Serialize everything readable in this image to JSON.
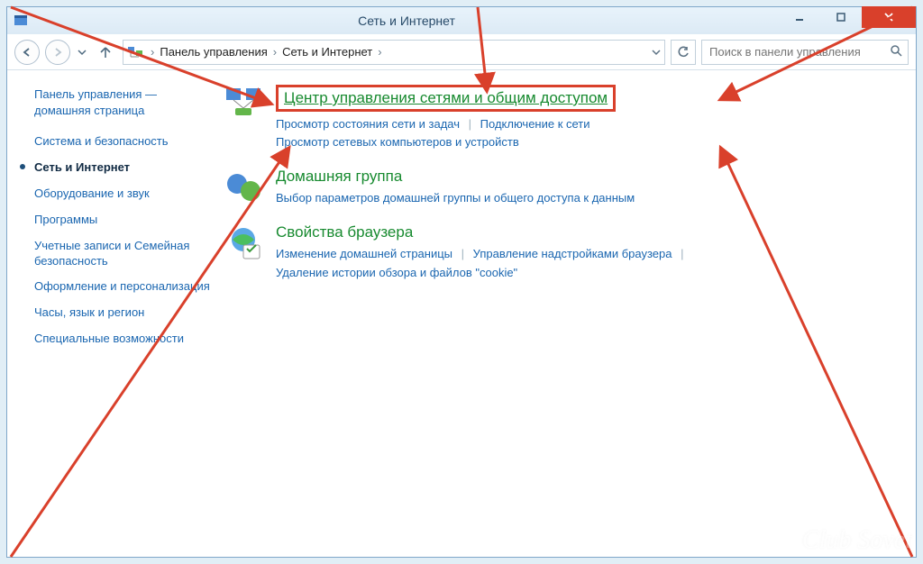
{
  "titlebar": {
    "title": "Сеть и Интернет"
  },
  "nav": {
    "crumb1": "Панель управления",
    "crumb2": "Сеть и Интернет",
    "search_placeholder": "Поиск в панели управления"
  },
  "sidebar": {
    "home_l1": "Панель управления —",
    "home_l2": "домашняя страница",
    "items": [
      {
        "label": "Система и безопасность"
      },
      {
        "label": "Сеть и Интернет"
      },
      {
        "label": "Оборудование и звук"
      },
      {
        "label": "Программы"
      },
      {
        "label": "Учетные записи и Семейная безопасность"
      },
      {
        "label": "Оформление и персонализация"
      },
      {
        "label": "Часы, язык и регион"
      },
      {
        "label": "Специальные возможности"
      }
    ]
  },
  "categories": {
    "c0": {
      "title": "Центр управления сетями и общим доступом",
      "l1": "Просмотр состояния сети и задач",
      "l2": "Подключение к сети",
      "l3": "Просмотр сетевых компьютеров и устройств"
    },
    "c1": {
      "title": "Домашняя группа",
      "l1": "Выбор параметров домашней группы и общего доступа к данным"
    },
    "c2": {
      "title": "Свойства браузера",
      "l1": "Изменение домашней страницы",
      "l2": "Управление надстройками браузера",
      "l3": "Удаление истории обзора и файлов \"cookie\""
    }
  },
  "watermark": "Club Sovet"
}
